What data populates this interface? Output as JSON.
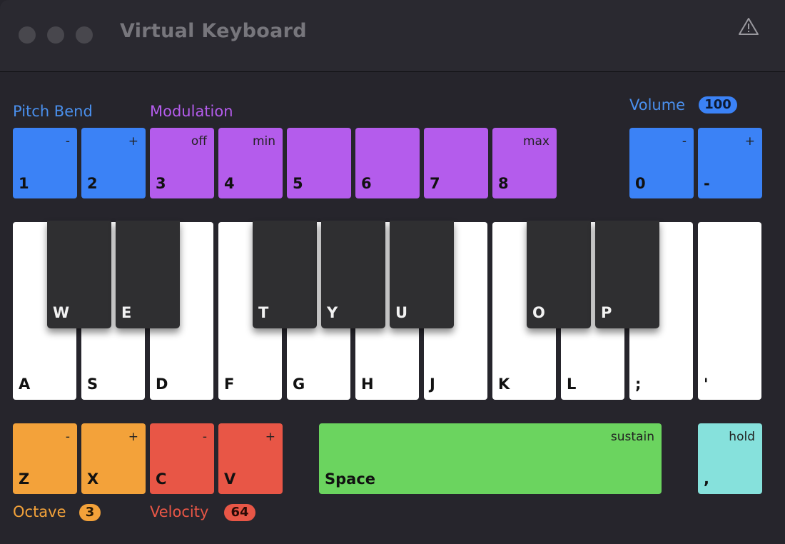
{
  "window": {
    "title": "Virtual Keyboard",
    "warning_icon": "warning-triangle-icon"
  },
  "labels": {
    "pitch_bend": "Pitch Bend",
    "modulation": "Modulation",
    "volume": "Volume",
    "octave": "Octave",
    "velocity": "Velocity"
  },
  "values": {
    "volume": "100",
    "octave": "3",
    "velocity": "64"
  },
  "pitch_keys": [
    {
      "key": "1",
      "sub": "-"
    },
    {
      "key": "2",
      "sub": "+"
    }
  ],
  "mod_keys": [
    {
      "key": "3",
      "sub": "off"
    },
    {
      "key": "4",
      "sub": "min"
    },
    {
      "key": "5",
      "sub": ""
    },
    {
      "key": "6",
      "sub": ""
    },
    {
      "key": "7",
      "sub": ""
    },
    {
      "key": "8",
      "sub": "max"
    }
  ],
  "volume_keys": [
    {
      "key": "0",
      "sub": "-"
    },
    {
      "key": "-",
      "sub": "+"
    }
  ],
  "white_keys": [
    "A",
    "S",
    "D",
    "F",
    "G",
    "H",
    "J",
    "K",
    "L",
    ";",
    "'"
  ],
  "black_keys": [
    "W",
    "E",
    "T",
    "Y",
    "U",
    "O",
    "P"
  ],
  "octave_keys": [
    {
      "key": "Z",
      "sub": "-"
    },
    {
      "key": "X",
      "sub": "+"
    }
  ],
  "velocity_keys": [
    {
      "key": "C",
      "sub": "-"
    },
    {
      "key": "V",
      "sub": "+"
    }
  ],
  "space_key": {
    "key": "Space",
    "sub": "sustain"
  },
  "hold_key": {
    "key": ",",
    "sub": "hold"
  },
  "colors": {
    "blue": "#3b82f6",
    "purple": "#b45cec",
    "orange": "#f3a23a",
    "red": "#e85646",
    "green": "#6bd45f",
    "cyan": "#86e1dc",
    "pitch_label": "#4a90ee",
    "mod_label": "#b45cec",
    "octave_label": "#f3a23a",
    "velocity_label": "#e85646"
  }
}
